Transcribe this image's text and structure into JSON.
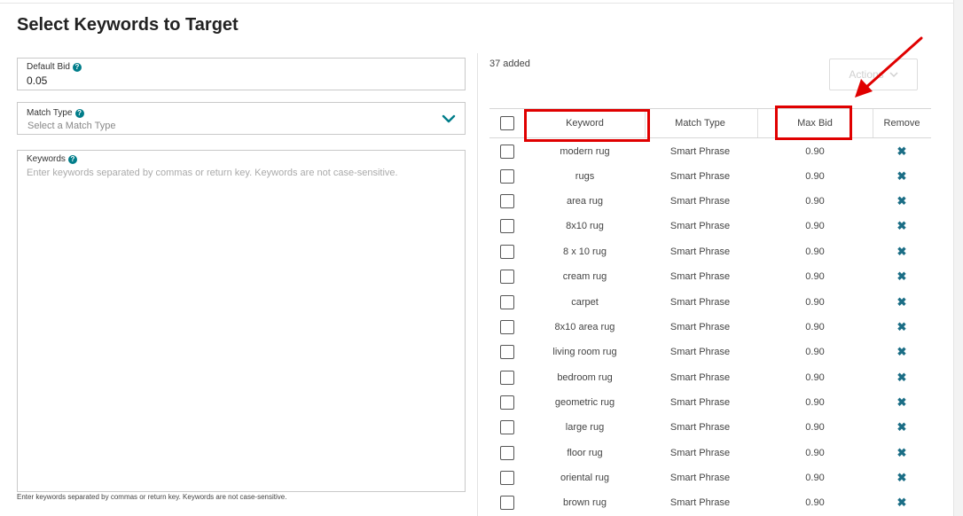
{
  "page": {
    "title": "Select Keywords to Target"
  },
  "form": {
    "default_bid": {
      "label": "Default Bid",
      "value": "0.05",
      "help": "?"
    },
    "match_type": {
      "label": "Match Type",
      "placeholder": "Select a Match Type",
      "help": "?"
    },
    "keywords": {
      "label": "Keywords",
      "placeholder": "Enter keywords separated by commas or return key. Keywords are not case-sensitive.",
      "help": "?"
    },
    "hint": "Enter keywords separated by commas or return key. Keywords are not case-sensitive."
  },
  "summary": {
    "added_text": "37 added"
  },
  "actions": {
    "label": "Actions"
  },
  "table": {
    "headers": {
      "keyword": "Keyword",
      "match_type": "Match Type",
      "max_bid": "Max Bid",
      "remove": "Remove"
    },
    "rows": [
      {
        "keyword": "modern rug",
        "match_type": "Smart Phrase",
        "max_bid": "0.90"
      },
      {
        "keyword": "rugs",
        "match_type": "Smart Phrase",
        "max_bid": "0.90"
      },
      {
        "keyword": "area rug",
        "match_type": "Smart Phrase",
        "max_bid": "0.90"
      },
      {
        "keyword": "8x10 rug",
        "match_type": "Smart Phrase",
        "max_bid": "0.90"
      },
      {
        "keyword": "8 x 10 rug",
        "match_type": "Smart Phrase",
        "max_bid": "0.90"
      },
      {
        "keyword": "cream rug",
        "match_type": "Smart Phrase",
        "max_bid": "0.90"
      },
      {
        "keyword": "carpet",
        "match_type": "Smart Phrase",
        "max_bid": "0.90"
      },
      {
        "keyword": "8x10 area rug",
        "match_type": "Smart Phrase",
        "max_bid": "0.90"
      },
      {
        "keyword": "living room rug",
        "match_type": "Smart Phrase",
        "max_bid": "0.90"
      },
      {
        "keyword": "bedroom rug",
        "match_type": "Smart Phrase",
        "max_bid": "0.90"
      },
      {
        "keyword": "geometric rug",
        "match_type": "Smart Phrase",
        "max_bid": "0.90"
      },
      {
        "keyword": "large rug",
        "match_type": "Smart Phrase",
        "max_bid": "0.90"
      },
      {
        "keyword": "floor rug",
        "match_type": "Smart Phrase",
        "max_bid": "0.90"
      },
      {
        "keyword": "oriental rug",
        "match_type": "Smart Phrase",
        "max_bid": "0.90"
      },
      {
        "keyword": "brown rug",
        "match_type": "Smart Phrase",
        "max_bid": "0.90"
      }
    ]
  },
  "icons": {
    "remove": "close-icon",
    "dropdown": "chevron-down-icon",
    "help": "help-circle-icon"
  },
  "colors": {
    "accent": "#007d8a",
    "remove": "#1a6d85",
    "highlight": "#e00000"
  }
}
